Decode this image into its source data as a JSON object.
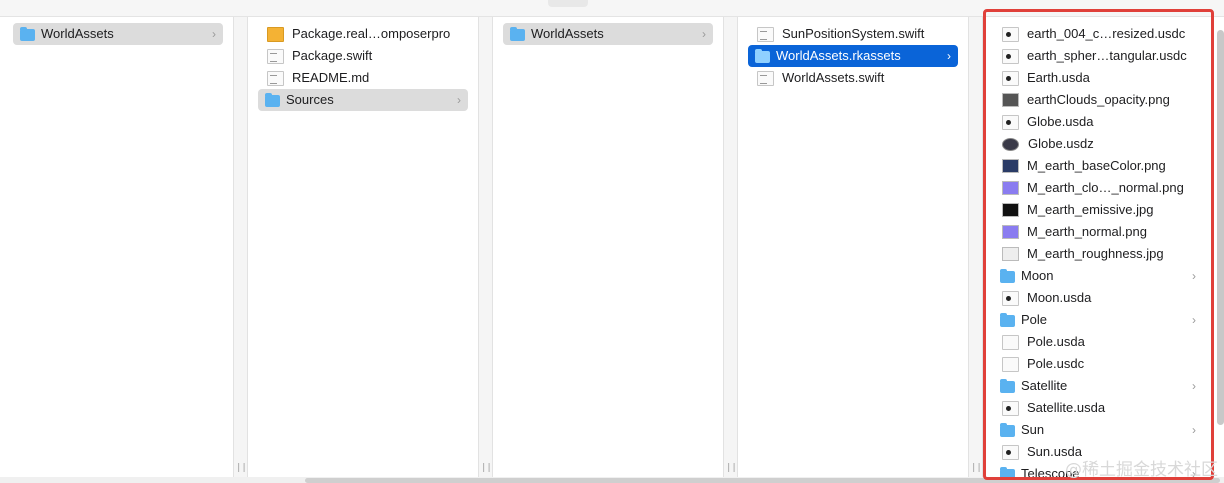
{
  "columns": [
    {
      "items": [
        {
          "label": "WorldAssets",
          "icon": "folder-icon",
          "state": "highlighted",
          "chevron": true
        }
      ]
    },
    {
      "items": [
        {
          "label": "Package.real…omposerpro",
          "icon": "package-icon",
          "state": "normal",
          "chevron": false
        },
        {
          "label": "Package.swift",
          "icon": "swift-file-icon",
          "state": "normal",
          "chevron": false
        },
        {
          "label": "README.md",
          "icon": "markdown-file-icon",
          "state": "normal",
          "chevron": false
        },
        {
          "label": "Sources",
          "icon": "folder-icon",
          "state": "highlighted",
          "chevron": true
        }
      ]
    },
    {
      "items": [
        {
          "label": "WorldAssets",
          "icon": "folder-icon",
          "state": "highlighted",
          "chevron": true
        }
      ]
    },
    {
      "items": [
        {
          "label": "SunPositionSystem.swift",
          "icon": "swift-file-icon",
          "state": "normal",
          "chevron": false
        },
        {
          "label": "WorldAssets.rkassets",
          "icon": "folder-icon",
          "state": "selected",
          "chevron": true
        },
        {
          "label": "WorldAssets.swift",
          "icon": "swift-file-icon",
          "state": "normal",
          "chevron": false
        }
      ]
    },
    {
      "items": [
        {
          "label": "earth_004_c…resized.usdc",
          "icon": "usd-file-icon",
          "chevron": false
        },
        {
          "label": "earth_spher…tangular.usdc",
          "icon": "usd-file-icon",
          "chevron": false
        },
        {
          "label": "Earth.usda",
          "icon": "usd-file-icon",
          "chevron": false
        },
        {
          "label": "earthClouds_opacity.png",
          "icon": "image-icon",
          "chevron": false
        },
        {
          "label": "Globe.usda",
          "icon": "usd-file-icon",
          "chevron": false
        },
        {
          "label": "Globe.usdz",
          "icon": "usdz-ball-icon",
          "chevron": false
        },
        {
          "label": "M_earth_baseColor.png",
          "icon": "image-icon",
          "chevron": false
        },
        {
          "label": "M_earth_clo…_normal.png",
          "icon": "image-icon",
          "chevron": false
        },
        {
          "label": "M_earth_emissive.jpg",
          "icon": "image-icon",
          "chevron": false
        },
        {
          "label": "M_earth_normal.png",
          "icon": "image-icon",
          "chevron": false
        },
        {
          "label": "M_earth_roughness.jpg",
          "icon": "image-icon",
          "chevron": false
        },
        {
          "label": "Moon",
          "icon": "folder-icon",
          "chevron": true
        },
        {
          "label": "Moon.usda",
          "icon": "usd-file-icon",
          "chevron": false
        },
        {
          "label": "Pole",
          "icon": "folder-icon",
          "chevron": true
        },
        {
          "label": "Pole.usda",
          "icon": "usd-file-icon",
          "chevron": false
        },
        {
          "label": "Pole.usdc",
          "icon": "usd-file-icon",
          "chevron": false
        },
        {
          "label": "Satellite",
          "icon": "folder-icon",
          "chevron": true
        },
        {
          "label": "Satellite.usda",
          "icon": "usd-file-icon",
          "chevron": false
        },
        {
          "label": "Sun",
          "icon": "folder-icon",
          "chevron": true
        },
        {
          "label": "Sun.usda",
          "icon": "usd-file-icon",
          "chevron": false
        },
        {
          "label": "Telescope",
          "icon": "folder-icon",
          "chevron": true
        }
      ]
    }
  ],
  "chevron_glyph": "›",
  "resizer_glyph": "||",
  "watermark": "@稀土掘金技术社区",
  "colors": {
    "selection": "#0a64d8",
    "highlight": "#dcdcdc",
    "folder": "#5ab2f0",
    "annotation_box": "#e0403a"
  }
}
